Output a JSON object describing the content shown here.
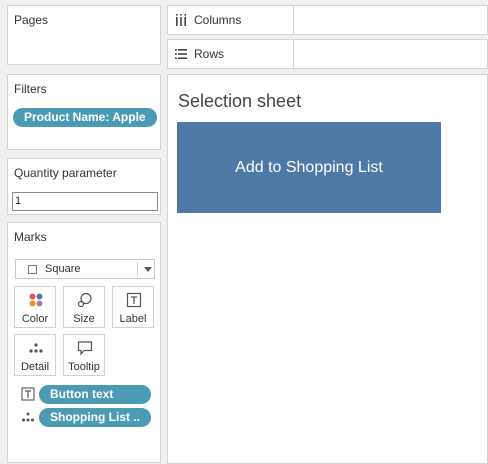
{
  "panels": {
    "pages": {
      "title": "Pages"
    },
    "filters": {
      "title": "Filters",
      "pill": "Product Name: Apple"
    },
    "quantity_parameter": {
      "title": "Quantity parameter",
      "value": "1"
    },
    "marks": {
      "title": "Marks",
      "mark_type": "Square",
      "buttons": [
        {
          "label": "Color",
          "icon": "color-icon"
        },
        {
          "label": "Size",
          "icon": "size-icon"
        },
        {
          "label": "Label",
          "icon": "label-icon"
        },
        {
          "label": "Detail",
          "icon": "detail-icon"
        },
        {
          "label": "Tooltip",
          "icon": "tooltip-icon"
        }
      ],
      "fields": [
        {
          "label": "Button text",
          "icon": "text-icon"
        },
        {
          "label": "Shopping List ..",
          "icon": "detail-icon"
        }
      ]
    }
  },
  "shelves": {
    "columns": "Columns",
    "rows": "Rows"
  },
  "view": {
    "title": "Selection sheet",
    "button_text": "Add to Shopping List"
  },
  "colors": {
    "pill": "#4b9bb5",
    "button": "#4e79a7"
  }
}
